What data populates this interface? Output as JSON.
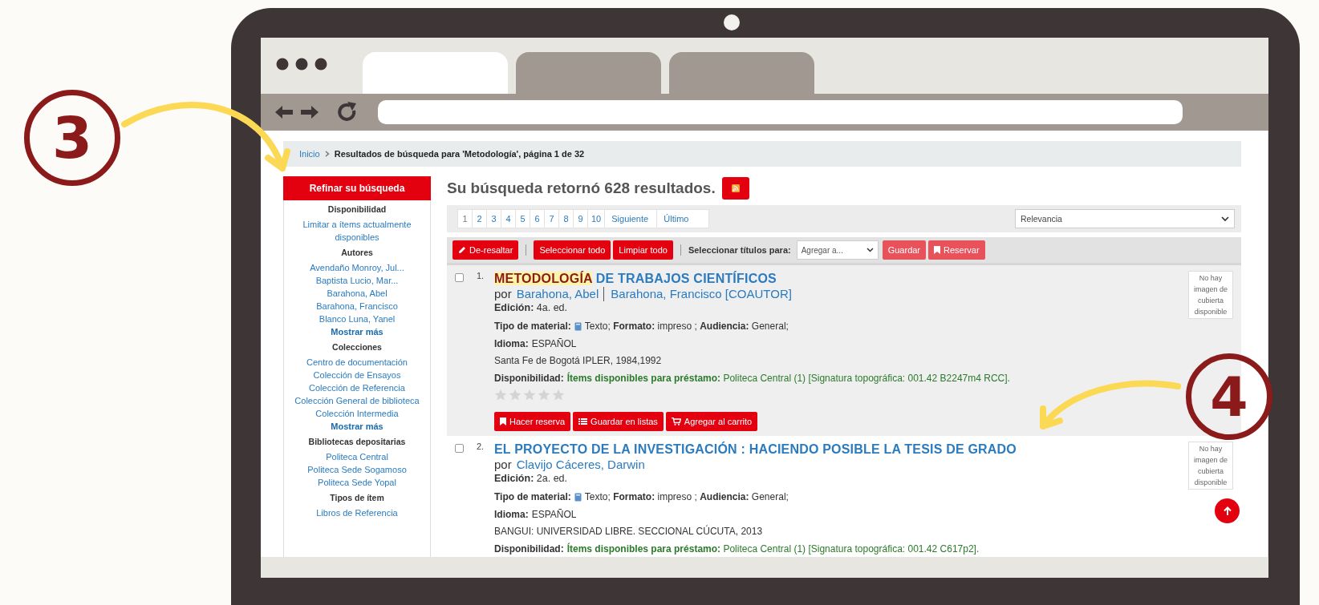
{
  "browser": {
    "tabs": [
      {
        "selected": true
      },
      {
        "selected": false
      },
      {
        "selected": false
      }
    ]
  },
  "breadcrumb": {
    "home": "Inicio",
    "current": "Resultados de búsqueda para 'Metodología', página 1 de 32"
  },
  "sidebar": {
    "title": "Refinar su búsqueda",
    "sections": [
      {
        "heading": "Disponibilidad",
        "items": [
          "Limitar a ítems actualmente disponibles"
        ]
      },
      {
        "heading": "Autores",
        "items": [
          "Avendaño Monroy, Jul...",
          "Baptista Lucio, Mar...",
          "Barahona, Abel",
          "Barahona, Francisco",
          "Blanco Luna, Yanel"
        ],
        "more": "Mostrar más"
      },
      {
        "heading": "Colecciones",
        "items": [
          "Centro de documentación",
          "Colección de Ensayos",
          "Colección de Referencia",
          "Colección General de biblioteca",
          "Colección Intermedia"
        ],
        "more": "Mostrar más"
      },
      {
        "heading": "Bibliotecas depositarias",
        "items": [
          "Politeca Central",
          "Politeca Sede Sogamoso",
          "Politeca Sede Yopal"
        ]
      },
      {
        "heading": "Tipos de ítem",
        "items": [
          "Libros de Referencia"
        ]
      }
    ]
  },
  "results_heading": "Su búsqueda retornó 628 resultados.",
  "pagination": {
    "pages": [
      {
        "label": "1",
        "selected": true
      },
      {
        "label": "2",
        "selected": false
      },
      {
        "label": "3",
        "selected": false
      },
      {
        "label": "4",
        "selected": false
      },
      {
        "label": "5",
        "selected": false
      },
      {
        "label": "6",
        "selected": false
      },
      {
        "label": "7",
        "selected": false
      },
      {
        "label": "8",
        "selected": false
      },
      {
        "label": "9",
        "selected": false
      },
      {
        "label": "10",
        "selected": false
      }
    ],
    "next": "Siguiente",
    "last": "Último"
  },
  "sort": {
    "value": "Relevancia"
  },
  "toolbar": {
    "buttons": [
      {
        "label": "De-resaltar",
        "disabled": false
      },
      {
        "label": "Seleccionar todo",
        "disabled": false
      },
      {
        "label": "Limpiar todo",
        "disabled": false
      }
    ],
    "select_label": "Seleccionar títulos para:",
    "select_value": "Agregar a...",
    "actions": [
      {
        "label": "Guardar",
        "disabled": true
      },
      {
        "label": "Reservar",
        "disabled": true
      }
    ]
  },
  "results": [
    {
      "number": "1.",
      "checked": false,
      "title": [
        {
          "text": "METODOLOGÍA",
          "highlighted": true
        },
        {
          "text": " DE TRABAJOS CIENTÍFICOS",
          "highlighted": false
        }
      ],
      "by": "por",
      "authors": [
        "Barahona, Abel",
        "Barahona, Francisco [COAUTOR]"
      ],
      "edition": "**Edición:** 4a. ed.",
      "material_label": "Tipo de material:",
      "material": "Texto; **Formato:** impreso ; **Audiencia:** General;",
      "language": "**Idioma:** ESPAÑOL",
      "publisher": "Santa Fe de Bogotá IPLER, 1984,1992",
      "availability_label": "Disponibilidad:",
      "availability": "**Ítems disponibles para préstamo:** Politeca Central (1) [Signatura topográfica: 001.42 B2247m4 RCC].",
      "stars": 0,
      "cover": "No hay imagen de cubierta disponible",
      "actions": [
        "Hacer reserva",
        "Guardar en listas",
        "Agregar al carrito"
      ]
    },
    {
      "number": "2.",
      "checked": false,
      "title": [
        {
          "text": "EL PROYECTO DE LA INVESTIGACIÓN : HACIENDO POSIBLE LA TESIS DE GRADO",
          "highlighted": false
        }
      ],
      "by": "por",
      "authors": [
        "Clavijo Cáceres, Darwin"
      ],
      "edition": "**Edición:** 2a. ed.",
      "material_label": "Tipo de material:",
      "material": "Texto; **Formato:** impreso ; **Audiencia:** General;",
      "language": "**Idioma:** ESPAÑOL",
      "publisher": "BANGUI: UNIVERSIDAD LIBRE. SECCIONAL CÚCUTA, 2013",
      "availability_label": "Disponibilidad:",
      "availability": "**Ítems disponibles para préstamo:** Politeca Central (1) [Signatura topográfica: 001.42 C617p2].",
      "cover": "No hay imagen de cubierta disponible"
    }
  ],
  "annotations": [
    {
      "number": "3"
    },
    {
      "number": "4"
    }
  ]
}
